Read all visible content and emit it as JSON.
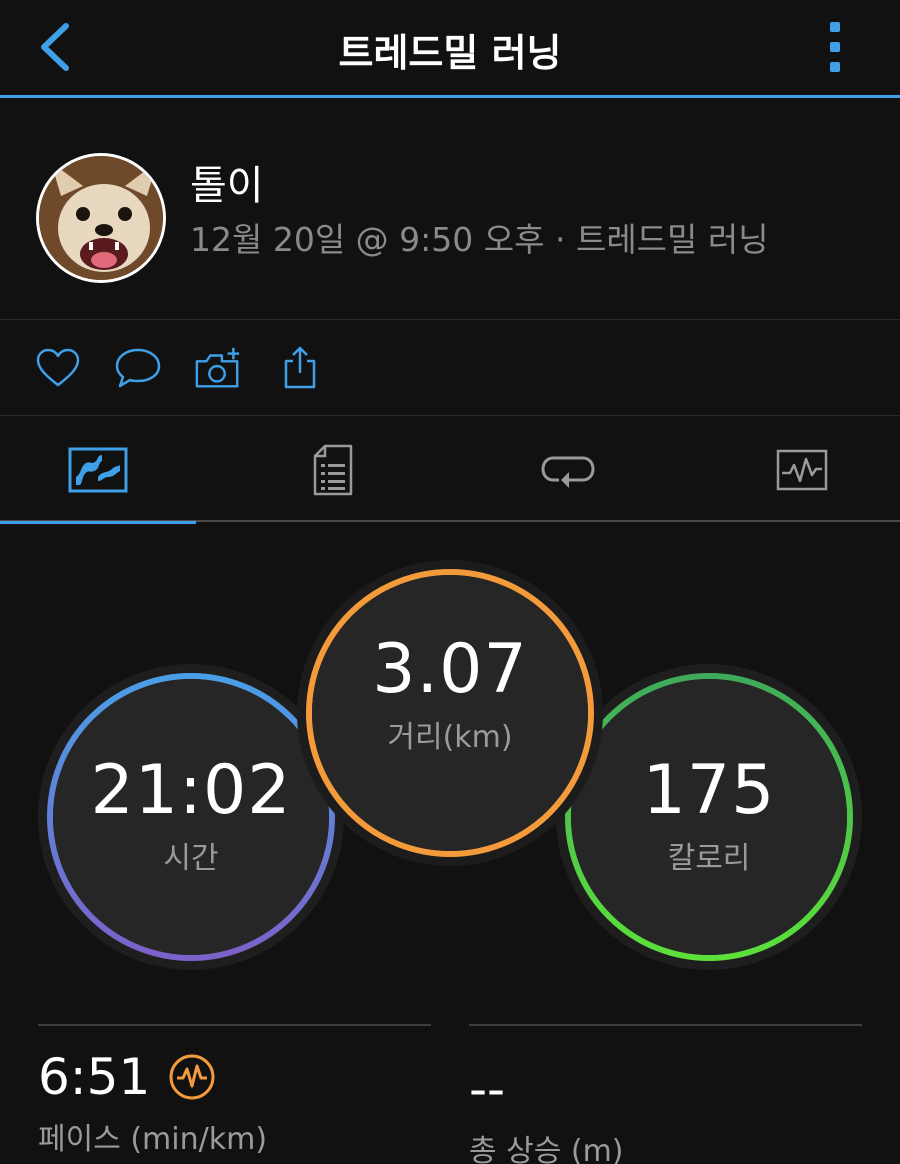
{
  "header": {
    "title": "트레드밀 러닝"
  },
  "profile": {
    "name": "톨이",
    "meta": "12월 20일 @ 9:50 오후 · 트레드밀 러닝"
  },
  "actions": {
    "icons": [
      "heart-icon",
      "comment-icon",
      "add-photo-icon",
      "share-icon"
    ]
  },
  "tabs": [
    {
      "icon": "overview-icon",
      "active": true
    },
    {
      "icon": "details-icon",
      "active": false
    },
    {
      "icon": "laps-icon",
      "active": false
    },
    {
      "icon": "chart-icon",
      "active": false
    }
  ],
  "summary": {
    "time": {
      "value": "21:02",
      "label": "시간"
    },
    "distance": {
      "value": "3.07",
      "label": "거리(km)"
    },
    "calories": {
      "value": "175",
      "label": "칼로리"
    }
  },
  "stats": {
    "pace": {
      "value": "6:51",
      "label": "페이스 (min/km)"
    },
    "ascent": {
      "value": "--",
      "label": "총 상승 (m)"
    }
  },
  "colors": {
    "accent": "#3fa0e8",
    "distance_ring": "#f39a3b",
    "calories_ring": "#4ccf4a",
    "time_ring_top": "#4a9ee6",
    "time_ring_bottom": "#7b61c8"
  }
}
